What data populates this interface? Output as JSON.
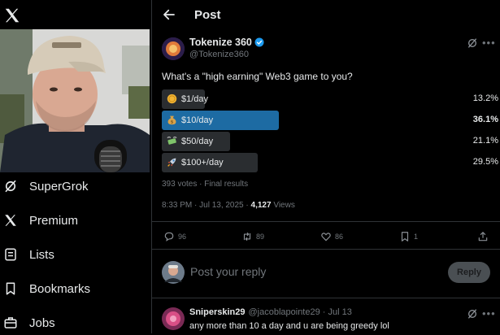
{
  "sidebar": {
    "items": [
      {
        "label": "SuperGrok",
        "icon": "grok-icon"
      },
      {
        "label": "Premium",
        "icon": "x-logo-icon"
      },
      {
        "label": "Lists",
        "icon": "list-icon"
      },
      {
        "label": "Bookmarks",
        "icon": "bookmark-icon"
      },
      {
        "label": "Jobs",
        "icon": "briefcase-icon"
      }
    ]
  },
  "header": {
    "title": "Post"
  },
  "post": {
    "author_name": "Tokenize 360",
    "author_handle": "@Tokenize360",
    "text": "What's a \"high earning\" Web3 game to you?",
    "poll": {
      "options": [
        {
          "label": "$1/day",
          "percent": "13.2%",
          "fraction": 0.132,
          "emoji": "coin-icon"
        },
        {
          "label": "$10/day",
          "percent": "36.1%",
          "fraction": 0.361,
          "emoji": "money-bag-icon",
          "winner": true
        },
        {
          "label": "$50/day",
          "percent": "21.1%",
          "fraction": 0.211,
          "emoji": "flying-money-icon"
        },
        {
          "label": "$100+/day",
          "percent": "29.5%",
          "fraction": 0.295,
          "emoji": "rocket-icon"
        }
      ],
      "summary": "393 votes · Final results"
    },
    "time_date": "8:33 PM · Jul 13, 2025 · ",
    "view_count": "4,127",
    "view_label": " Views",
    "stats": {
      "replies": "96",
      "reposts": "89",
      "likes": "86",
      "bookmarks": "1"
    }
  },
  "reply_box": {
    "placeholder": "Post your reply",
    "button": "Reply"
  },
  "comment": {
    "name": "Sniperskin29",
    "meta": "@jacoblapointe29 · Jul 13",
    "text": "any more than 10 a day and u are being greedy lol"
  },
  "colors": {
    "accent": "#1d9bf0",
    "poll_winner": "#1d6ba3",
    "poll_bar": "#2a2d30"
  }
}
